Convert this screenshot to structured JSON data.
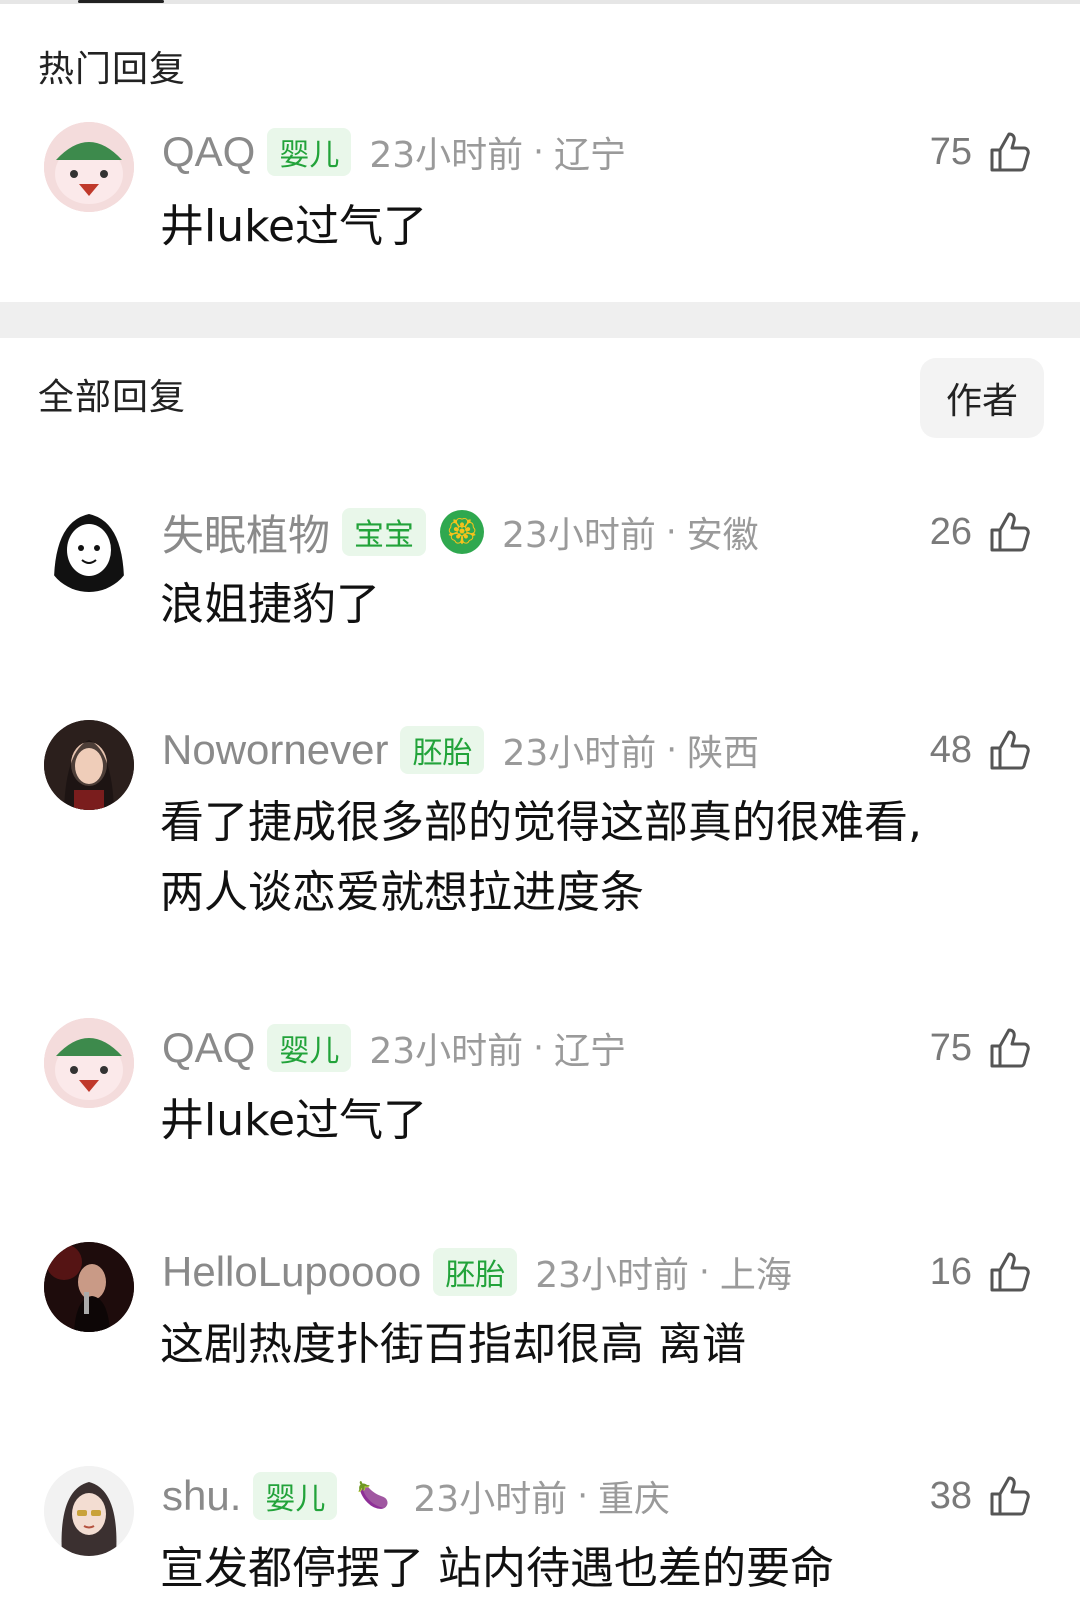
{
  "hot_section": {
    "title": "热门回复"
  },
  "all_section": {
    "title": "全部回复",
    "filter_button": "作者"
  },
  "hot_comments": [
    {
      "username": "QAQ",
      "badge": "婴儿",
      "time": "23小时前",
      "region": "辽宁",
      "likes": "75",
      "text": "井luke过气了"
    }
  ],
  "comments": [
    {
      "username": "失眠植物",
      "badge": "宝宝",
      "extra_icon": "🏵",
      "time": "23小时前",
      "region": "安徽",
      "likes": "26",
      "text": "浪姐捷豹了"
    },
    {
      "username": "Nowornever",
      "badge": "胚胎",
      "time": "23小时前",
      "region": "陕西",
      "likes": "48",
      "text_line1": "看了捷成很多部的觉得这部真的很难看,",
      "text_line2": "两人谈恋爱就想拉进度条"
    },
    {
      "username": "QAQ",
      "badge": "婴儿",
      "time": "23小时前",
      "region": "辽宁",
      "likes": "75",
      "text": "井luke过气了"
    },
    {
      "username": "HelloLupoooo",
      "badge": "胚胎",
      "time": "23小时前",
      "region": "上海",
      "likes": "16",
      "text": "这剧热度扑街百指却很高 离谱"
    },
    {
      "username": "shu.",
      "badge": "婴儿",
      "extra_icon": "🍆",
      "time": "23小时前",
      "region": "重庆",
      "likes": "38",
      "text": "宣发都停摆了 站内待遇也差的要命"
    }
  ],
  "separator": "·",
  "colors": {
    "badge_bg": "#e9f7ea",
    "badge_text": "#22a33a",
    "meta_text": "#9a9a9a"
  }
}
